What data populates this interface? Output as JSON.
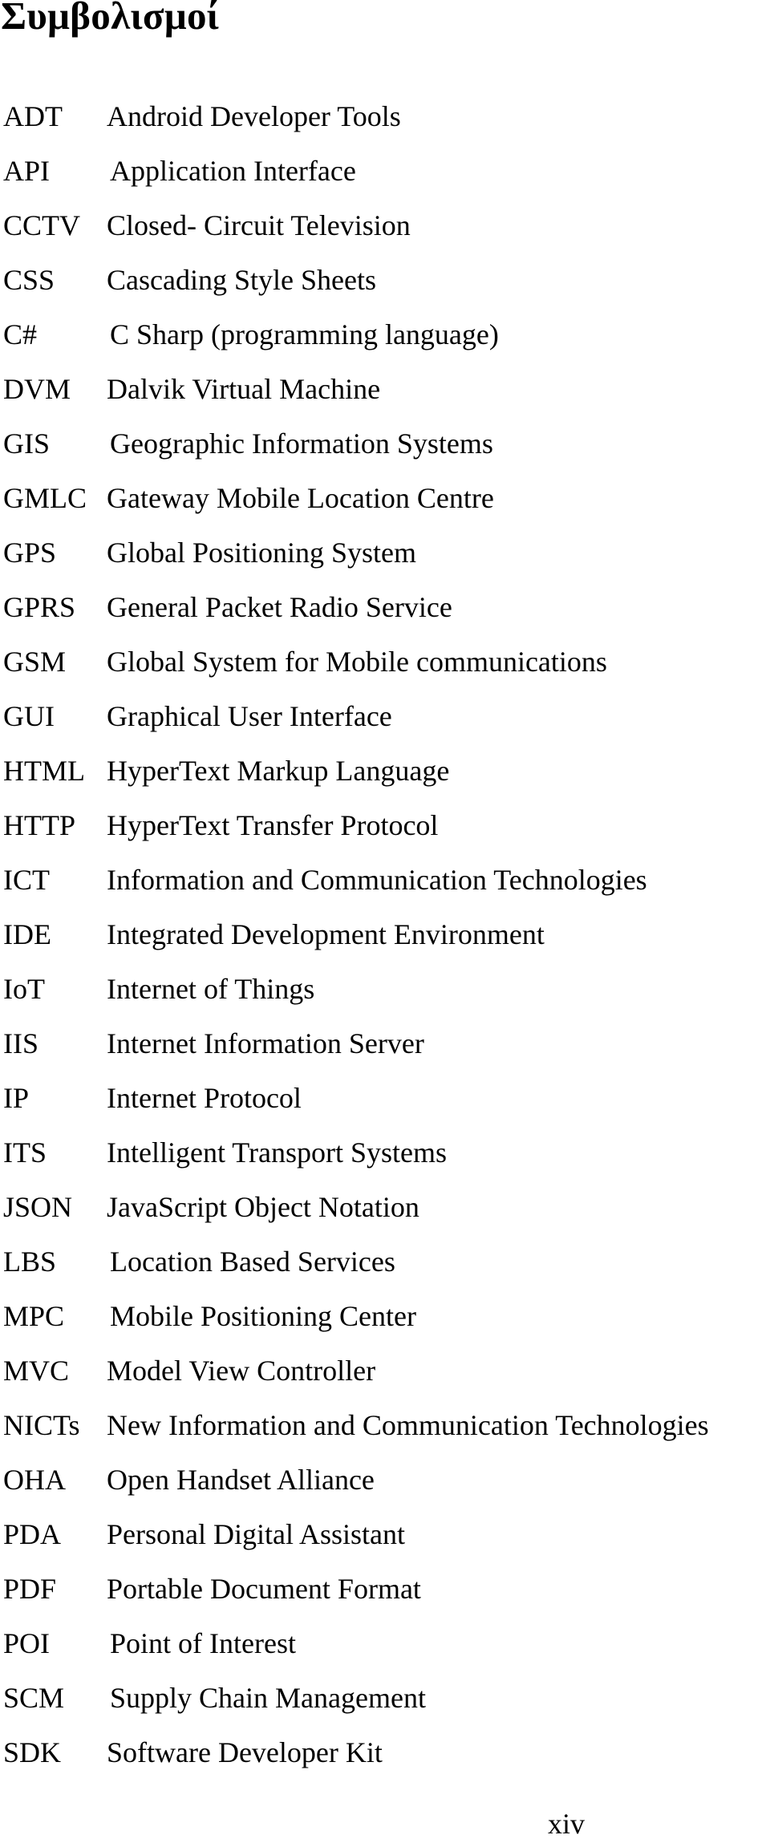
{
  "document": {
    "title": "Συμβολισμοί",
    "page_number": "xiv",
    "abbreviations": [
      {
        "term": "ADT",
        "definition": "Android Developer Tools"
      },
      {
        "term": "API",
        "definition": "Application Interface"
      },
      {
        "term": "CCTV",
        "definition": "Closed- Circuit Television"
      },
      {
        "term": "CSS",
        "definition": "Cascading Style Sheets"
      },
      {
        "term": "C#",
        "definition": "C Sharp (programming language)"
      },
      {
        "term": "DVM",
        "definition": "Dalvik Virtual Machine"
      },
      {
        "term": "GIS",
        "definition": "Geographic Information Systems"
      },
      {
        "term": "GMLC",
        "definition": "Gateway Mobile Location Centre"
      },
      {
        "term": "GPS",
        "definition": "Global Positioning System"
      },
      {
        "term": "GPRS",
        "definition": "General Packet Radio Service"
      },
      {
        "term": "GSM",
        "definition": "Global System for Mobile communications"
      },
      {
        "term": "GUI",
        "definition": "Graphical User Interface"
      },
      {
        "term": "HTML",
        "definition": "HyperText Markup Language"
      },
      {
        "term": "HTTP",
        "definition": "HyperText Transfer Protocol"
      },
      {
        "term": "ICT",
        "definition": "Information and Communication Technologies"
      },
      {
        "term": "IDE",
        "definition": "Integrated Development Environment"
      },
      {
        "term": "IoT",
        "definition": "Internet of Things"
      },
      {
        "term": "IIS",
        "definition": "Internet Information Server"
      },
      {
        "term": "IP",
        "definition": "Internet Protocol"
      },
      {
        "term": "ITS",
        "definition": "Intelligent Transport Systems"
      },
      {
        "term": "JSON",
        "definition": "JavaScript Object Notation"
      },
      {
        "term": "LBS",
        "definition": "Location Based Services"
      },
      {
        "term": "MPC",
        "definition": "Mobile Positioning Center"
      },
      {
        "term": "MVC",
        "definition": "Model View Controller"
      },
      {
        "term": "NICTs",
        "definition": "New Information and Communication Technologies"
      },
      {
        "term": "OHA",
        "definition": "Open Handset Alliance"
      },
      {
        "term": "PDA",
        "definition": "Personal Digital Assistant"
      },
      {
        "term": "PDF",
        "definition": "Portable Document Format"
      },
      {
        "term": "POI",
        "definition": "Point of Interest"
      },
      {
        "term": "SCM",
        "definition": "Supply Chain Management"
      },
      {
        "term": "SDK",
        "definition": "Software Developer Kit"
      }
    ]
  }
}
